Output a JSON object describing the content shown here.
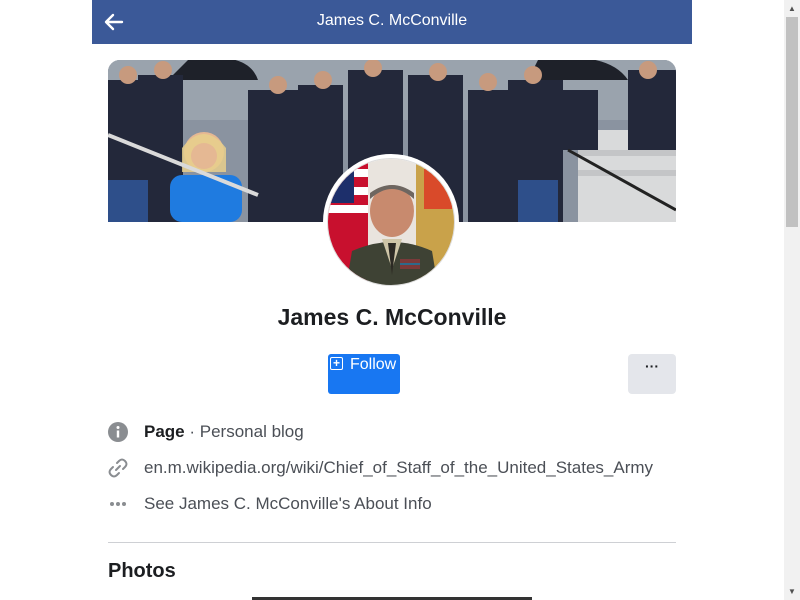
{
  "header": {
    "title": "James C. McConville",
    "back_icon": "arrow-left-icon",
    "bg_color": "#3b5998"
  },
  "profile": {
    "name": "James C. McConville",
    "follow_label": "Follow",
    "more_label": "···",
    "follow_color": "#1877f2"
  },
  "info": {
    "page_label": "Page",
    "separator": " · ",
    "category": "Personal blog",
    "link": "en.m.wikipedia.org/wiki/Chief_of_Staff_of_the_United_States_Army",
    "about": "See James C. McConville's About Info"
  },
  "sections": {
    "photos_title": "Photos"
  }
}
